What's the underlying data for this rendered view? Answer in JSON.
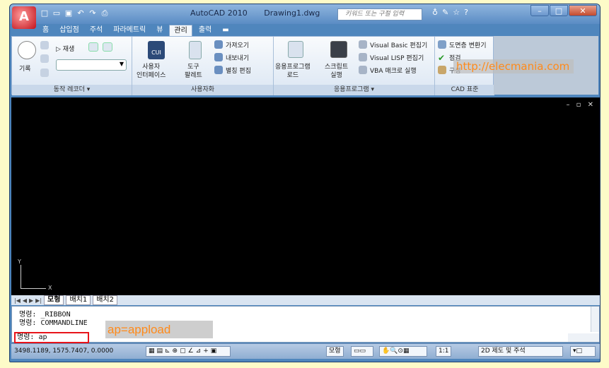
{
  "window": {
    "app_name": "AutoCAD 2010",
    "file_name": "Drawing1.dwg",
    "search_placeholder": "키워드 또는 구절 입력"
  },
  "ribbon_tabs": [
    "홈",
    "삽입점",
    "주석",
    "파라메트릭",
    "뷰",
    "관리",
    "출력"
  ],
  "active_tab": "관리",
  "panels": {
    "action_recorder": {
      "record": "기록",
      "play": "▷ 재생",
      "footer": "동작 레코더 ▾"
    },
    "customize": {
      "ui": "사용자\n인터페이스",
      "ui_icon_text": "CUI",
      "tool_palette": "도구\n팔레트",
      "import": "가져오기",
      "export": "내보내기",
      "alias_edit": "별칭 편집",
      "footer": "사용자화"
    },
    "applications": {
      "load_app": "응용프로그램\n로드",
      "run_script": "스크립트\n실행",
      "vb_editor": "Visual Basic 편집기",
      "lisp_editor": "Visual LISP 편집기",
      "vba_macro": "VBA 매크로 실행",
      "footer": "응용프로그램 ▾"
    },
    "cad_standards": {
      "layer_translate": "도면층 변환기",
      "check": "점검",
      "configure": "구성",
      "footer": "CAD 표준"
    }
  },
  "watermark": "http://elecmania.com",
  "layout_tabs": [
    "모형",
    "배치1",
    "배치2"
  ],
  "active_layout": "모형",
  "ucs": {
    "x": "X",
    "y": "Y"
  },
  "command_history": [
    {
      "prompt": "명령:",
      "text": "_RIBBON"
    },
    {
      "prompt": "명령:",
      "text": "COMMANDLINE"
    }
  ],
  "command_input": {
    "prompt": "명령:",
    "text": "ap"
  },
  "annotation": "ap=appload",
  "status": {
    "coords": "3498.1189, 1575.7407, 0.0000",
    "model": "모형",
    "scale": "1:1",
    "workspace": "2D 제도 및 주석"
  },
  "colors": {
    "accent": "#4f86bd",
    "highlight": "#e8141a",
    "watermark": "#ff8a1a"
  }
}
